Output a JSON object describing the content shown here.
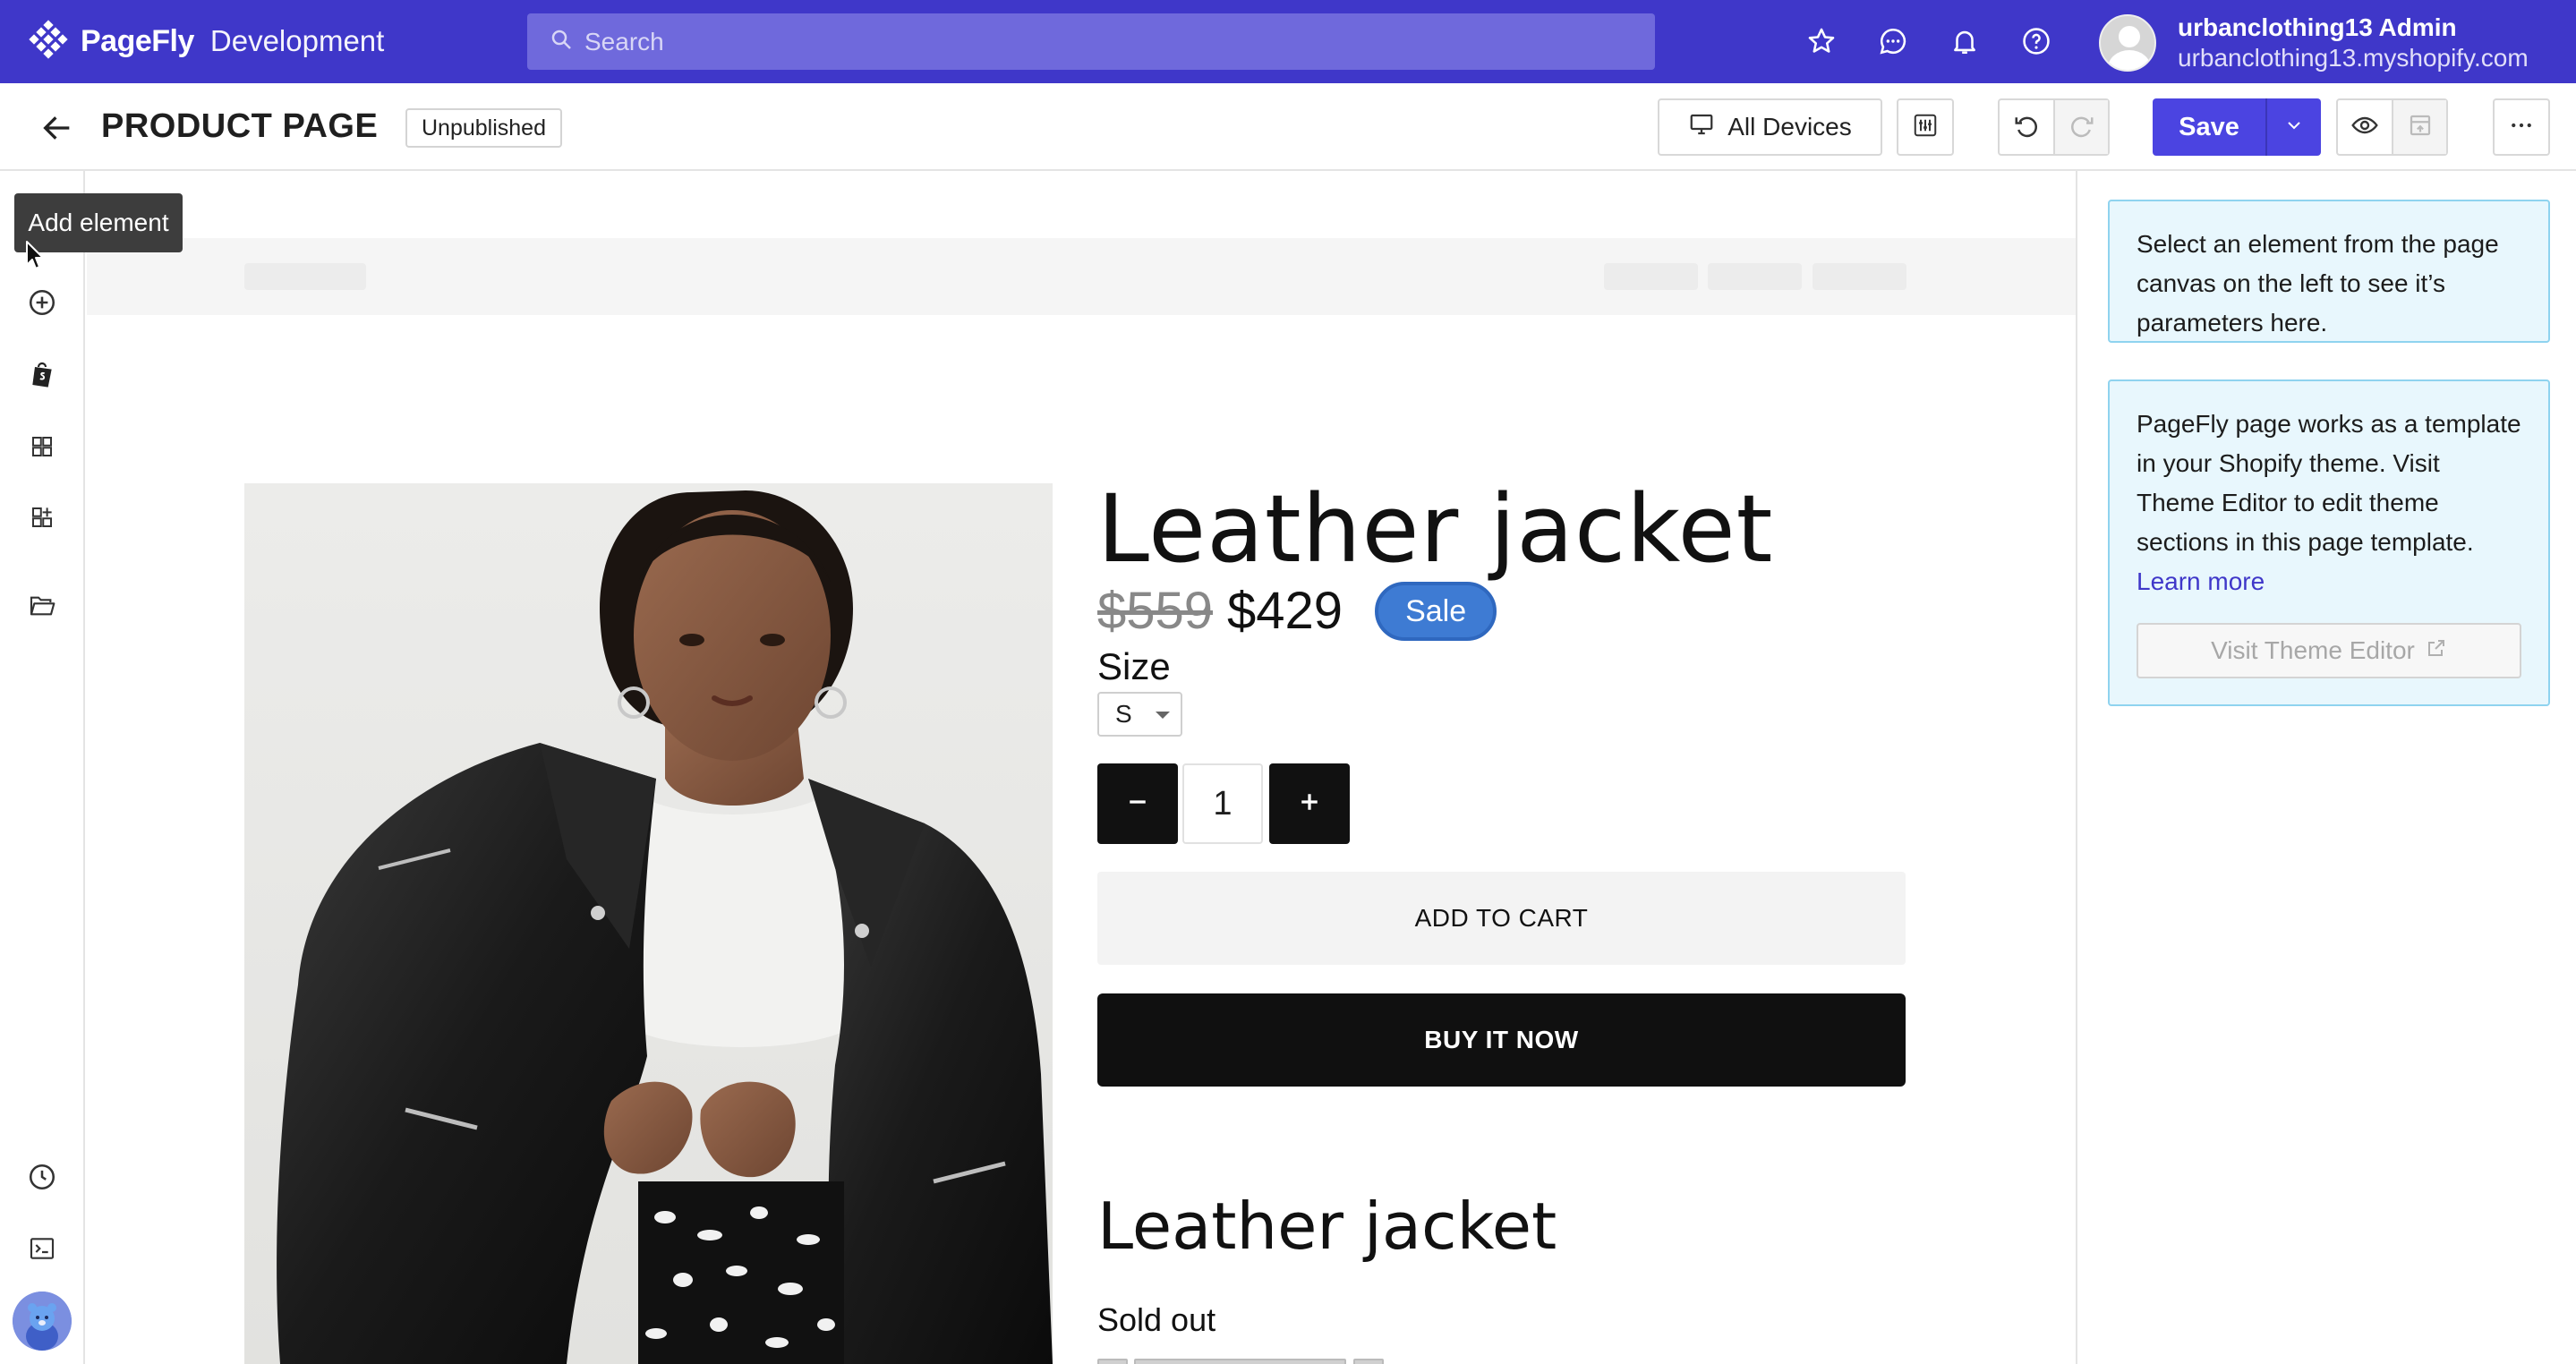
{
  "app": {
    "logo_name": "PageFly",
    "environment": "Development"
  },
  "search": {
    "placeholder": "Search"
  },
  "user": {
    "name": "urbanclothing13 Admin",
    "store": "urbanclothing13.myshopify.com"
  },
  "header": {
    "title": "PRODUCT PAGE",
    "status": "Unpublished",
    "devices_label": "All Devices",
    "save_label": "Save"
  },
  "sidebar": {
    "tooltip": "Add element"
  },
  "product": {
    "title": "Leather jacket",
    "price_old": "$559",
    "price_new": "$429",
    "badge": "Sale",
    "size_label": "Size",
    "size_value": "S",
    "quantity": "1",
    "add_to_cart": "ADD TO CART",
    "buy_now": "BUY IT NOW",
    "title_secondary": "Leather jacket",
    "stock_status": "Sold out"
  },
  "inspector": {
    "hint": "Select an element from the page canvas on the left to see it’s parameters here.",
    "template_note": "PageFly page works as a template in your Shopify theme. Visit Theme Editor to edit theme sections in this page template.",
    "learn_more": "Learn more",
    "theme_editor_button": "Visit Theme Editor"
  },
  "colors": {
    "brand": "#3f37c9",
    "save": "#4b44e1",
    "sale_badge": "#3e7bd3",
    "info_bg": "#e8f7fd"
  }
}
